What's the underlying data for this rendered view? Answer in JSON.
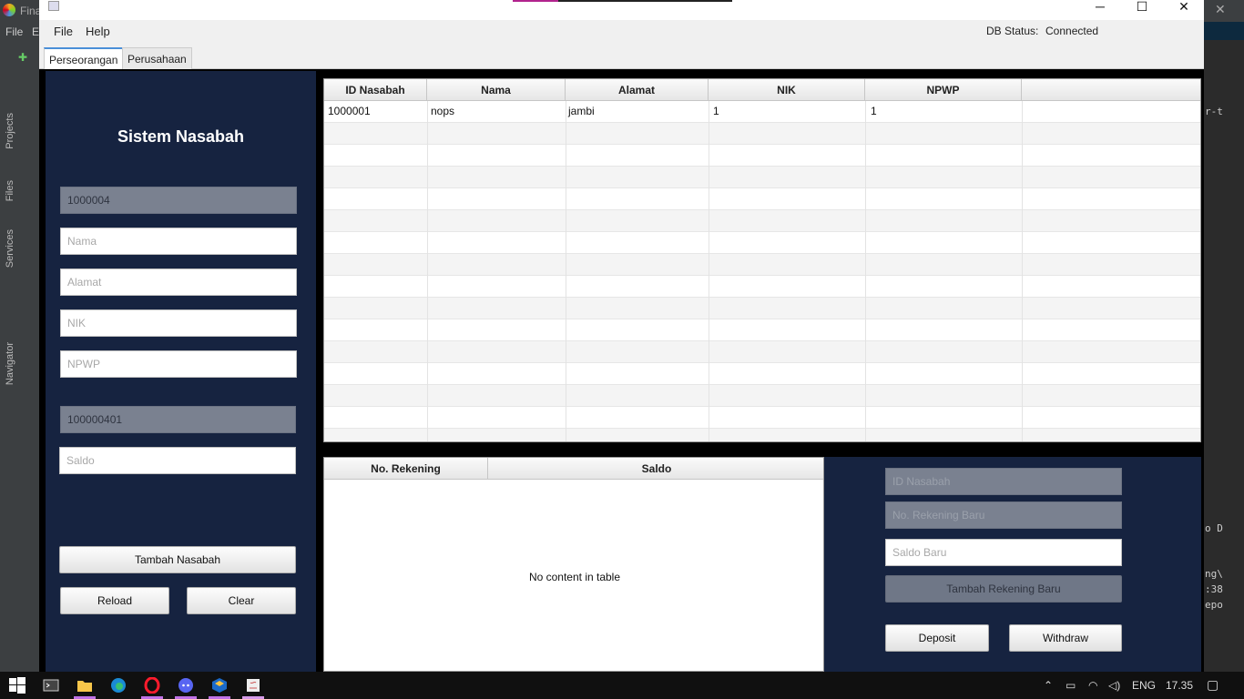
{
  "ide": {
    "title": "Fina",
    "menu": [
      "File",
      "E"
    ],
    "side_tabs": [
      "Projects",
      "Files",
      "Services",
      "Navigator"
    ],
    "right_text": [
      "r-t",
      "o D",
      "ng\\",
      ":38",
      "epo"
    ]
  },
  "window": {
    "menu": [
      "File",
      "Help"
    ],
    "db_status_label": "DB Status:",
    "db_status_value": "Connected",
    "tabs": [
      "Perseorangan",
      "Perusahaan"
    ]
  },
  "form": {
    "title": "Sistem Nasabah",
    "id_nasabah": "1000004",
    "nama_placeholder": "Nama",
    "alamat_placeholder": "Alamat",
    "nik_placeholder": "NIK",
    "npwp_placeholder": "NPWP",
    "no_rekening": "100000401",
    "saldo_placeholder": "Saldo",
    "add_button": "Tambah Nasabah",
    "reload_button": "Reload",
    "clear_button": "Clear"
  },
  "nasabah_table": {
    "columns": [
      "ID Nasabah",
      "Nama",
      "Alamat",
      "NIK",
      "NPWP"
    ],
    "rows": [
      [
        "1000001",
        "nops",
        "jambi",
        "1",
        "1"
      ]
    ]
  },
  "rekening_table": {
    "columns": [
      "No. Rekening",
      "Saldo"
    ],
    "empty_text": "No content in table"
  },
  "account_form": {
    "id_placeholder": "ID Nasabah",
    "no_rekening_placeholder": "No. Rekening Baru",
    "saldo_placeholder": "Saldo Baru",
    "add_button": "Tambah Rekening Baru",
    "deposit_button": "Deposit",
    "withdraw_button": "Withdraw"
  },
  "taskbar": {
    "lang": "ENG",
    "time": "17.35"
  },
  "colors": {
    "panel": "#162340",
    "accent": "#4a8fd8"
  }
}
